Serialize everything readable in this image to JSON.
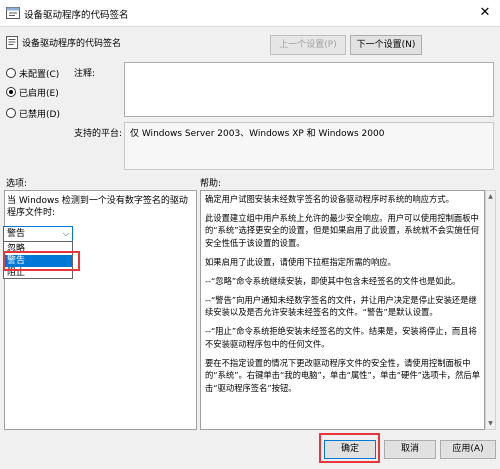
{
  "window": {
    "title": "设备驱动程序的代码签名",
    "close_glyph": "✕"
  },
  "header": {
    "title": "设备驱动程序的代码签名",
    "prev_label": "上一个设置(P)",
    "next_label": "下一个设置(N)"
  },
  "state": {
    "options": [
      {
        "label": "未配置(C)",
        "checked": false
      },
      {
        "label": "已启用(E)",
        "checked": true
      },
      {
        "label": "已禁用(D)",
        "checked": false
      }
    ],
    "comment_label": "注释:",
    "comment_value": "",
    "platform_label": "支持的平台:",
    "platform_value": "仅 Windows Server 2003、Windows XP 和 Windows 2000"
  },
  "options_pane": {
    "title": "选项:",
    "prompt_line1": "当 Windows 检测到一个没有数字签名的驱动",
    "prompt_line2": "程序文件时:",
    "selected": "警告",
    "items": [
      "忽略",
      "警告",
      "阻止"
    ]
  },
  "help_pane": {
    "title": "帮助:",
    "paragraphs": [
      "确定用户试图安装未经数字签名的设备驱动程序时系统的响应方式。",
      "此设置建立组中用户系统上允许的最少安全响应。用户可以使用控制面板中的“系统”选择更安全的设置，但是如果启用了此设置，系统就不会实施任何安全性低于该设置的设置。",
      "如果启用了此设置，请使用下拉框指定所需的响应。",
      "--“忽略”命令系统继续安装，即使其中包含未经签名的文件也是如此。",
      "--“警告”向用户通知未经数字签名的文件，并让用户决定是停止安装还是继续安装以及是否允许安装未经签名的文件。“警告”是默认设置。",
      "--“阻止”命令系统拒绝安装未经签名的文件。结果是，安装将停止，而且将不安装驱动程序包中的任何文件。",
      "要在不指定设置的情况下更改驱动程序文件的安全性，请使用控制面板中的“系统”。右键单击“我的电脑”，单击“属性”，单击“硬件”选项卡，然后单击“驱动程序签名”按钮。"
    ]
  },
  "footer": {
    "ok_label": "确定",
    "cancel_label": "取消",
    "apply_label": "应用(A)"
  },
  "colors": {
    "highlight": "#0078d7",
    "annotation": "#e8353b"
  }
}
